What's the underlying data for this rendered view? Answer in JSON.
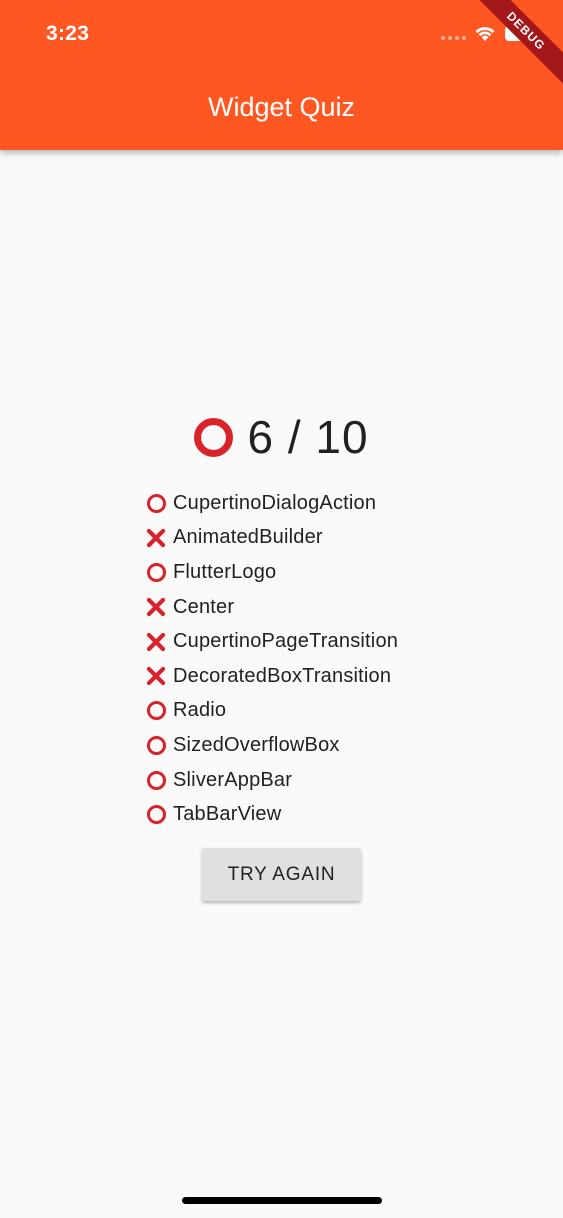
{
  "status_bar": {
    "time": "3:23"
  },
  "debug_banner": "DEBUG",
  "app_bar": {
    "title": "Widget Quiz"
  },
  "score": {
    "icon": "red-circle-icon",
    "text": "6 / 10",
    "correct": 6,
    "total": 10
  },
  "results": [
    {
      "label": "CupertinoDialogAction",
      "correct": true
    },
    {
      "label": "AnimatedBuilder",
      "correct": false
    },
    {
      "label": "FlutterLogo",
      "correct": true
    },
    {
      "label": "Center",
      "correct": false
    },
    {
      "label": "CupertinoPageTransition",
      "correct": false
    },
    {
      "label": "DecoratedBoxTransition",
      "correct": false
    },
    {
      "label": "Radio",
      "correct": true
    },
    {
      "label": "SizedOverflowBox",
      "correct": true
    },
    {
      "label": "SliverAppBar",
      "correct": true
    },
    {
      "label": "TabBarView",
      "correct": true
    }
  ],
  "actions": {
    "try_again_label": "TRY AGAIN"
  },
  "colors": {
    "app_bar": "#FF5722",
    "mark": "#D8232A",
    "background": "#FAFAFA",
    "button": "#E0E0E0"
  }
}
